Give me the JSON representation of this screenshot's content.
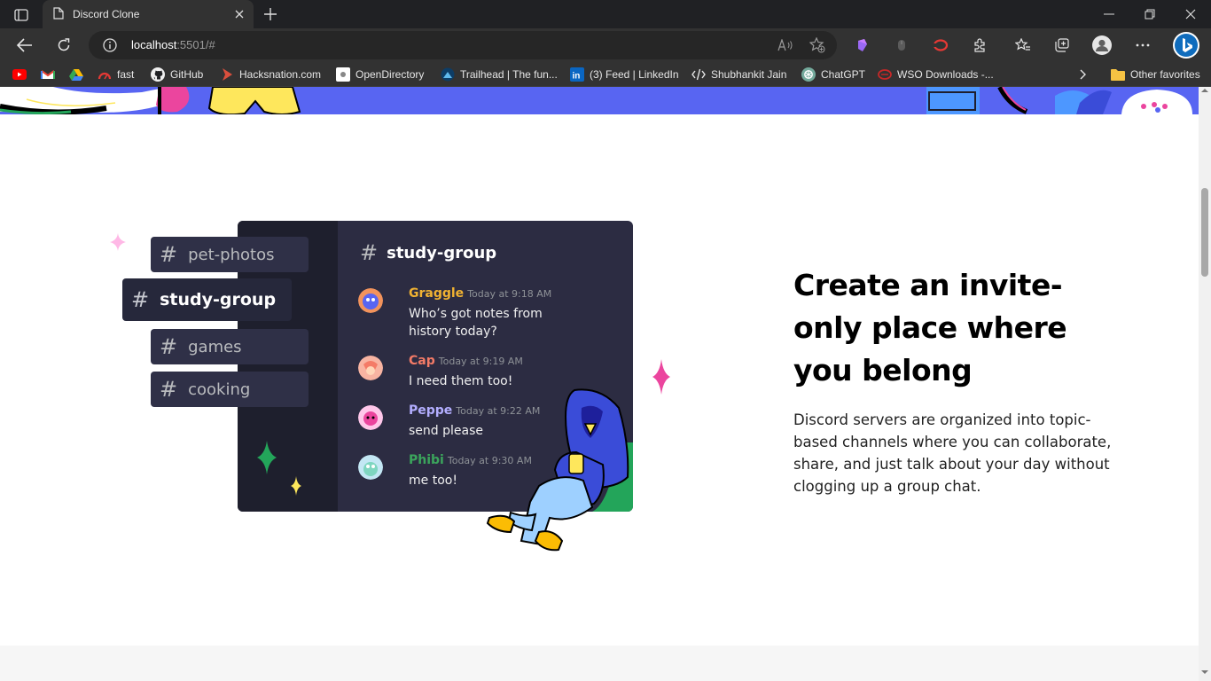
{
  "browser": {
    "tab_title": "Discord Clone",
    "url_host": "localhost",
    "url_path": ":5501/#"
  },
  "bookmarks": [
    {
      "label": "",
      "icon": "youtube-icon"
    },
    {
      "label": "",
      "icon": "gmail-icon"
    },
    {
      "label": "",
      "icon": "drive-icon"
    },
    {
      "label": "fast",
      "icon": "speedometer-icon"
    },
    {
      "label": "GitHub",
      "icon": "github-icon"
    },
    {
      "label": "Hacksnation.com",
      "icon": "hacksnation-icon"
    },
    {
      "label": "OpenDirectory",
      "icon": "directory-icon"
    },
    {
      "label": "Trailhead | The fun...",
      "icon": "trailhead-icon"
    },
    {
      "label": "(3) Feed | LinkedIn",
      "icon": "linkedin-icon"
    },
    {
      "label": "Shubhankit Jain",
      "icon": "code-icon"
    },
    {
      "label": "ChatGPT",
      "icon": "chatgpt-icon"
    },
    {
      "label": "WSO Downloads -...",
      "icon": "wso-icon"
    }
  ],
  "other_favorites": "Other favorites",
  "illustration": {
    "channels": [
      "pet-photos",
      "study-group",
      "games",
      "cooking"
    ],
    "active_channel": "study-group",
    "header_channel": "study-group",
    "messages": [
      {
        "author": "Graggle",
        "time": "Today at 9:18 AM",
        "text": "Who’s got notes from history today?",
        "color": "#f0b232"
      },
      {
        "author": "Cap",
        "time": "Today at 9:19 AM",
        "text": "I need them too!",
        "color": "#f47b67"
      },
      {
        "author": "Peppe",
        "time": "Today at 9:22 AM",
        "text": "send please",
        "color": "#b3aeff"
      },
      {
        "author": "Phibi",
        "time": "Today at 9:30 AM",
        "text": "me too!",
        "color": "#3ba55c"
      }
    ]
  },
  "section": {
    "headline": "Create an invite-only place where you belong",
    "body": "Discord servers are organized into topic-based channels where you can collaborate, share, and just talk about your day without clogging up a group chat."
  },
  "colors": {
    "blurple": "#5865f2",
    "accent_pink": "#eb459e",
    "accent_green": "#23a55a",
    "accent_yellow": "#fee75c"
  }
}
